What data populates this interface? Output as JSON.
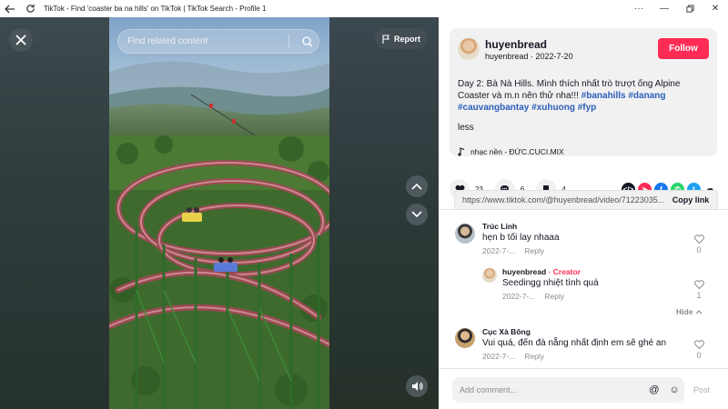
{
  "window": {
    "title": "TikTok - Find 'coaster ba na hills' on TikTok | TikTok Search - Profile 1",
    "back_icon": "back-arrow-icon",
    "reload_icon": "reload-icon"
  },
  "video": {
    "search_placeholder": "Find related content",
    "report_label": "Report"
  },
  "post": {
    "author_name": "huyenbread",
    "author_meta": "huyenbread · 2022-7-20",
    "follow_label": "Follow",
    "desc_plain": "Day 2: Bà Nà Hills. Mình thích nhất trò trượt ống Alpine Coaster và m.n nên thử nha!!!",
    "hashtags": [
      "#banahills",
      "#danang",
      "#cauvangbantay",
      "#xuhuong",
      "#fyp"
    ],
    "less_label": "less",
    "music_label": "nhạc nền - ĐỨC.CUCI.MIX"
  },
  "actions": {
    "likes": "23",
    "comments": "6",
    "saves": "4"
  },
  "share": {
    "url": "https://www.tiktok.com/@huyenbread/video/71223035...",
    "copy_label": "Copy link",
    "colors": {
      "embed": "#161823",
      "friends": "#fe2c55",
      "facebook": "#1877f2",
      "whatsapp": "#25d366",
      "twitter": "#1da1f2",
      "more": "#161823"
    }
  },
  "comments": [
    {
      "name": "Trúc Linh",
      "text": "hẹn b tối lay nhaaa",
      "date": "2022-7-...",
      "reply": "Reply",
      "likes": "0"
    },
    {
      "name": "huyenbread",
      "badge": "· Creator",
      "text": "Seedingg nhiệt tình quá",
      "date": "2022-7-...",
      "reply": "Reply",
      "likes": "1"
    },
    {
      "name": "Cục Xà Bông",
      "text": "Vui quá, đến đà nẵng nhất định em sẽ ghé an",
      "date": "2022-7-...",
      "reply": "Reply",
      "likes": "0"
    }
  ],
  "hide_label": "Hide",
  "composer": {
    "placeholder": "Add comment...",
    "post_label": "Post"
  },
  "colors": {
    "accent": "#fe2c55",
    "hashtag": "#2b5db9"
  }
}
